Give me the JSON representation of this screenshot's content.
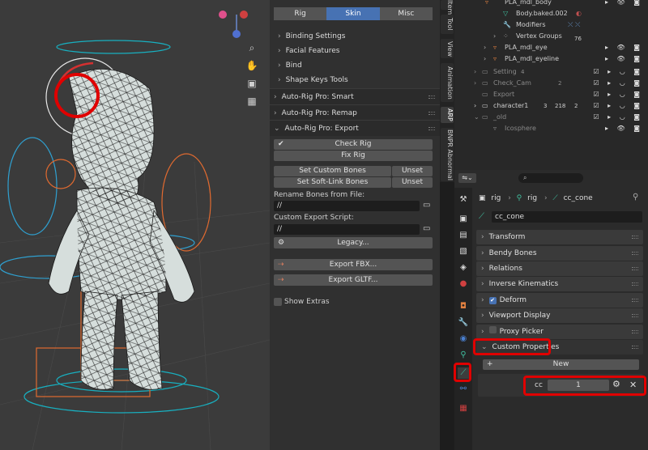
{
  "arp_tabs": [
    "Rig",
    "Skin",
    "Misc"
  ],
  "arp_skin_items": [
    "Binding Settings",
    "Facial Features",
    "Bind",
    "Shape Keys Tools"
  ],
  "arp_sections": {
    "smart": "Auto-Rig Pro: Smart",
    "remap": "Auto-Rig Pro: Remap",
    "export": "Auto-Rig Pro: Export"
  },
  "export": {
    "check_rig": "Check Rig",
    "fix_rig": "Fix Rig",
    "set_custom_bones": "Set Custom Bones",
    "set_softlink_bones": "Set Soft-Link Bones",
    "unset": "Unset",
    "rename_label": "Rename Bones from File:",
    "rename_value": "//",
    "script_label": "Custom Export Script:",
    "script_value": "//",
    "legacy": "Legacy...",
    "export_fbx": "Export FBX...",
    "export_gltf": "Export GLTF...",
    "show_extras": "Show Extras"
  },
  "vtabs": [
    "Item",
    "Tool",
    "View",
    "Animation",
    "ARP",
    "BNPR Abnormal"
  ],
  "outliner": [
    {
      "name": "PLA_mdl_body",
      "indent": 2
    },
    {
      "name": "Body.baked.002",
      "indent": 4
    },
    {
      "name": "Modifiers",
      "indent": 4
    },
    {
      "name": "Vertex Groups",
      "indent": 4
    },
    {
      "name": "PLA_mdl_eye",
      "indent": 3
    },
    {
      "name": "PLA_mdl_eyeline",
      "indent": 3
    },
    {
      "name": "Setting",
      "indent": 1
    },
    {
      "name": "Check_Cam",
      "indent": 1
    },
    {
      "name": "Export",
      "indent": 1
    },
    {
      "name": "character1",
      "indent": 1
    },
    {
      "name": "_old",
      "indent": 1
    },
    {
      "name": "Icosphere",
      "indent": 2
    }
  ],
  "outliner_badges": {
    "setting": "4",
    "check_cam": "2",
    "character1_a": "3",
    "character1_b": "218",
    "character1_c": "2",
    "vertex_groups": "76"
  },
  "props": {
    "breadcrumb_rig": "rig",
    "breadcrumb_armature": "rig",
    "breadcrumb_bone": "cc_cone",
    "bone_name": "cc_cone",
    "sections": [
      "Transform",
      "Bendy Bones",
      "Relations",
      "Inverse Kinematics",
      "Deform",
      "Viewport Display",
      "Proxy Picker",
      "Custom Properties"
    ],
    "new_button": "New",
    "prop_name": "cc",
    "prop_value": "1"
  }
}
